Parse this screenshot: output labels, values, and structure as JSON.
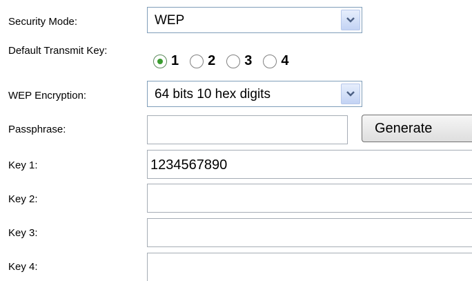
{
  "security": {
    "label": "Security Mode:",
    "value": "WEP"
  },
  "transmit_key": {
    "label": "Default Transmit Key:",
    "options": [
      "1",
      "2",
      "3",
      "4"
    ],
    "selected": "1"
  },
  "encryption": {
    "label": "WEP Encryption:",
    "value": "64 bits 10 hex digits"
  },
  "passphrase": {
    "label": "Passphrase:",
    "value": "",
    "button": "Generate"
  },
  "keys": [
    {
      "label": "Key 1:",
      "value": "1234567890"
    },
    {
      "label": "Key 2:",
      "value": ""
    },
    {
      "label": "Key 3:",
      "value": ""
    },
    {
      "label": "Key 4:",
      "value": ""
    }
  ],
  "colors": {
    "accent_radio": "#3a9c2f",
    "arrow_bg": "#c3d3f4"
  }
}
